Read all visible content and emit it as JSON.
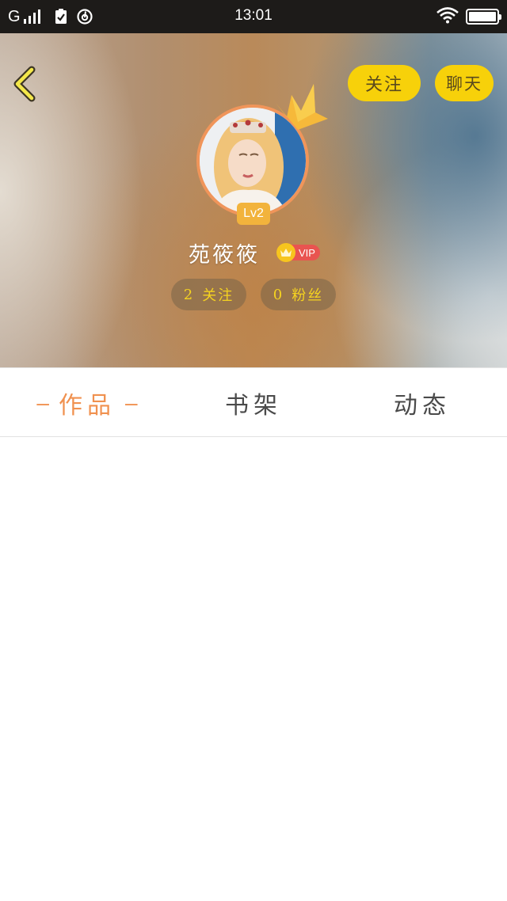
{
  "status_bar": {
    "carrier": "G",
    "time": "13:01",
    "battery_level": 1.0,
    "icons": [
      "signal-icon",
      "clipboard-check-icon",
      "netease-music-icon",
      "wifi-icon",
      "battery-icon"
    ]
  },
  "header": {
    "back_icon": "chevron-left-icon",
    "follow_label": "关注",
    "chat_label": "聊天",
    "accent_color": "#f7d10a"
  },
  "profile": {
    "username": "苑筱筱",
    "level": "Lv2",
    "vip_label": "VIP",
    "following_count": "2",
    "following_label": "关注",
    "fans_count": "0",
    "fans_label": "粉丝",
    "avatar_border_color": "#f0955a"
  },
  "tabs": [
    {
      "label": "作品",
      "active": true
    },
    {
      "label": "书架",
      "active": false
    },
    {
      "label": "动态",
      "active": false
    }
  ],
  "active_tab_color": "#f0914f"
}
